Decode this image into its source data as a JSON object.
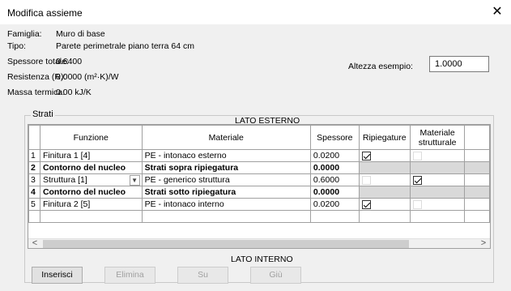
{
  "window": {
    "title": "Modifica assieme",
    "close_glyph": "✕"
  },
  "properties": [
    {
      "label": "Famiglia:",
      "value": "Muro di base"
    },
    {
      "label": "Tipo:",
      "value": "Parete perimetrale piano terra 64 cm"
    },
    {
      "label": "Spessore totale:",
      "value": "0.6400"
    },
    {
      "label": "Resistenza (R):",
      "value": "0.0000 (m²·K)/W"
    },
    {
      "label": "Massa termica:",
      "value": "0.00 kJ/K"
    }
  ],
  "sample_height": {
    "label": "Altezza esempio:",
    "value": "1.0000"
  },
  "layers": {
    "group_title": "Strati",
    "exterior_label": "LATO ESTERNO",
    "interior_label": "LATO INTERNO",
    "columns": [
      "",
      "Funzione",
      "Materiale",
      "Spessore",
      "Ripiegature",
      "Materiale strutturale"
    ],
    "rows": [
      {
        "num": "1",
        "function": "Finitura 1 [4]",
        "material": "PE - intonaco esterno",
        "thickness": "0.0200",
        "wraps": true,
        "structural": false,
        "bold": false
      },
      {
        "num": "2",
        "function": "Contorno del nucleo",
        "material": "Strati sopra ripiegatura",
        "thickness": "0.0000",
        "wraps": null,
        "structural": null,
        "bold": true
      },
      {
        "num": "3",
        "function": "Struttura [1]",
        "material": "PE - generico struttura",
        "thickness": "0.6000",
        "wraps": false,
        "structural": true,
        "bold": false,
        "editing": true
      },
      {
        "num": "4",
        "function": "Contorno del nucleo",
        "material": "Strati sotto ripiegatura",
        "thickness": "0.0000",
        "wraps": null,
        "structural": null,
        "bold": true
      },
      {
        "num": "5",
        "function": "Finitura 2 [5]",
        "material": "PE - intonaco interno",
        "thickness": "0.0200",
        "wraps": true,
        "structural": false,
        "bold": false
      }
    ]
  },
  "buttons": {
    "insert": "Inserisci",
    "delete": "Elimina",
    "up": "Su",
    "down": "Giù"
  }
}
